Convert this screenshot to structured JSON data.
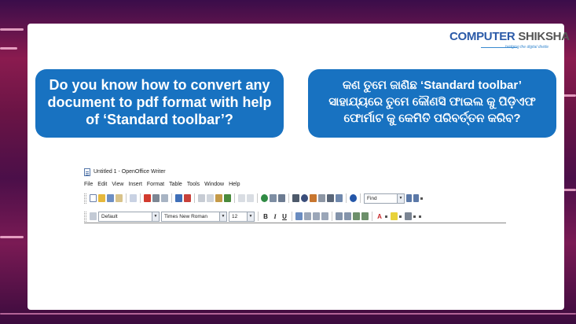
{
  "brand": {
    "name_part1": "COMPUTER",
    "name_part2": "SHIKSHA",
    "tagline": "bridging the digital divide"
  },
  "question_english": {
    "line1": "Do you know how to convert any",
    "line2": "document to pdf format with help",
    "line3": "of ‘Standard toolbar’?"
  },
  "question_odia": {
    "line1": "କଣ ତୁମେ ଜାଣିଛ ‘Standard toolbar’",
    "line2": "ସାହାଯ୍ୟରେ ତୁମେ କୌଣସି ଫାଇଲ କୁ ପିଡ଼ିଏଫ",
    "line3": "ଫୋର୍ମାଟ କୁ କେମିତି ପରିବର୍ତ୍ତନ କରିବ?"
  },
  "screenshot": {
    "window_title": "Untitled 1 - OpenOffice Writer",
    "menu": [
      "File",
      "Edit",
      "View",
      "Insert",
      "Format",
      "Table",
      "Tools",
      "Window",
      "Help"
    ],
    "find_placeholder": "Find",
    "paragraph_style": "Default",
    "font_name": "Times New Roman",
    "font_size": "12",
    "bold_label": "B",
    "italic_label": "I",
    "underline_label": "U",
    "font_color_label": "A"
  },
  "colors": {
    "bubble": "#1872c1",
    "brand_blue": "#2b5aa8",
    "background": "#6a1445"
  }
}
